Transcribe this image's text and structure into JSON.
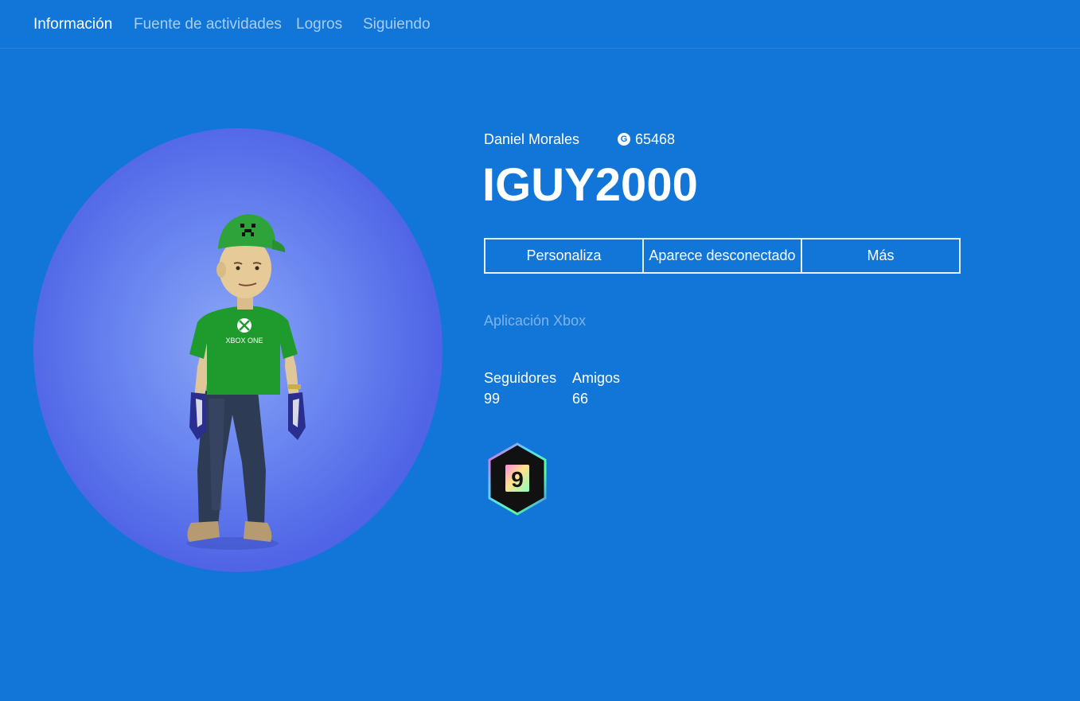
{
  "nav": {
    "tabs": [
      {
        "label": "Información",
        "active": true
      },
      {
        "label": "Fuente de actividades",
        "active": false
      },
      {
        "label": "Logros",
        "active": false
      },
      {
        "label": "Siguiendo",
        "active": false
      }
    ]
  },
  "profile": {
    "real_name": "Daniel Morales",
    "gamerscore": "65468",
    "gamerscore_icon": "G",
    "gamertag": "IGUY2000",
    "presence": "Aplicación Xbox",
    "shirt_text": "XBOX ONE"
  },
  "actions": {
    "customize": "Personaliza",
    "appear_offline": "Aparece desconectado",
    "more": "Más"
  },
  "stats": {
    "followers_label": "Seguidores",
    "followers_value": "99",
    "friends_label": "Amigos",
    "friends_value": "66"
  },
  "badge": {
    "tier": "9"
  },
  "colors": {
    "background": "#1176d8",
    "avatar_bg": "#4f64e6",
    "subtle_text": "#7fb3ec"
  }
}
